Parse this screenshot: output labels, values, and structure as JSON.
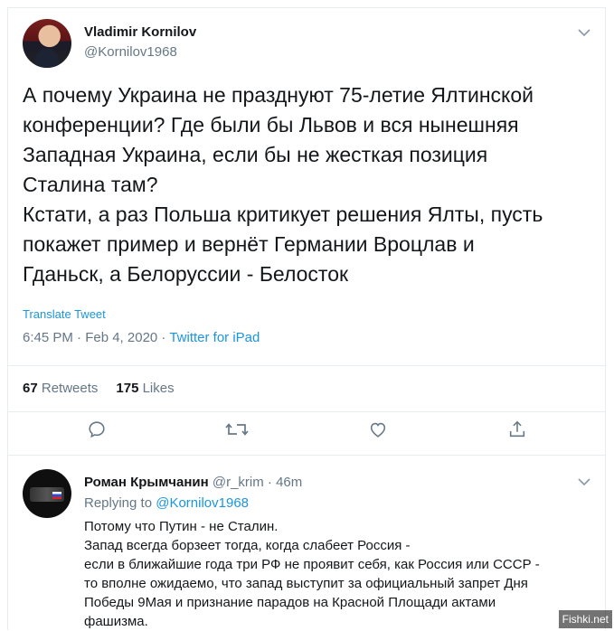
{
  "tweet": {
    "author_name": "Vladimir Kornilov",
    "author_handle": "@Kornilov1968",
    "text": "А почему Украина не празднуют 75-летие Ялтинской\nконференции? Где были бы Львов и вся нынешняя\nЗападная Украина, если бы не жесткая позиция\nСталина там?\nКстати, а раз Польша критикует решения Ялты, пусть\nпокажет пример и вернёт Германии Вроцлав и\nГданьск, а Белоруссии - Белосток",
    "translate_label": "Translate Tweet",
    "time": "6:45 PM · Feb 4, 2020 · ",
    "source": "Twitter for iPad",
    "retweets_count": "67",
    "retweets_label": "Retweets",
    "likes_count": "175",
    "likes_label": "Likes"
  },
  "reply": {
    "author_name": "Роман Крымчанин",
    "author_handle": "@r_krim · 46m",
    "replying_prefix": "Replying to ",
    "replying_to": "@Kornilov1968",
    "text": "Потому что Путин - не Сталин.\nЗапад всегда борзеет тогда, когда слабеет Россия -\nесли в ближайшие года три РФ не проявит себя, как Россия или СССР -\nто вполне ожидаемо, что запад выступит за официальный запрет Дня\nПобеды 9Мая и признание парадов на Красной Площади актами\nфашизма."
  },
  "icons": [
    "chevron-down-icon",
    "reply-icon",
    "retweet-icon",
    "like-icon",
    "share-icon"
  ],
  "colors": {
    "link": "#1b95e0",
    "secondary": "#657786",
    "text": "#14171a",
    "divider": "#e6ecf0"
  },
  "watermark": "Fishki.net"
}
